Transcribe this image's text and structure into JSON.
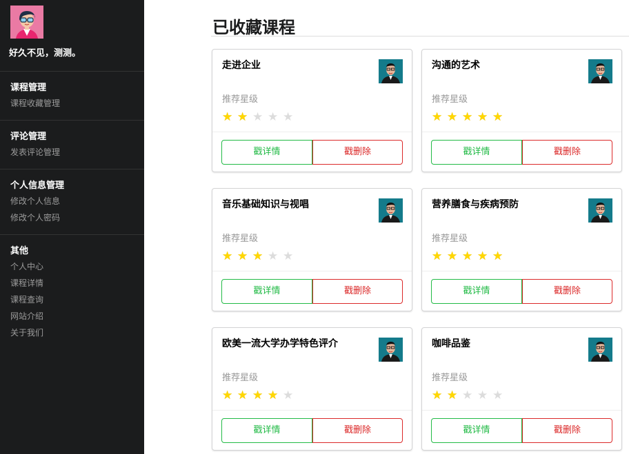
{
  "user": {
    "greeting": "好久不见，测测。"
  },
  "sidebar": {
    "sections": [
      {
        "title": "课程管理",
        "items": [
          "课程收藏管理"
        ]
      },
      {
        "title": "评论管理",
        "items": [
          "发表评论管理"
        ]
      },
      {
        "title": "个人信息管理",
        "items": [
          "修改个人信息",
          "修改个人密码"
        ]
      },
      {
        "title": "其他",
        "items": [
          "个人中心",
          "课程详情",
          "课程查询",
          "网站介绍",
          "关于我们"
        ]
      }
    ]
  },
  "main": {
    "title": "已收藏课程",
    "rating_label": "推荐星级",
    "detail_label": "戳详情",
    "delete_label": "戳删除",
    "colors": {
      "green": "#21ba45",
      "red": "#db2828",
      "star": "#ffd700",
      "sidebar_bg": "#1b1c1d"
    },
    "courses": [
      {
        "title": "走进企业",
        "rating": 2
      },
      {
        "title": "沟通的艺术",
        "rating": 5
      },
      {
        "title": "音乐基础知识与视唱",
        "rating": 3
      },
      {
        "title": "营养膳食与疾病预防",
        "rating": 5
      },
      {
        "title": "欧美一流大学办学特色评介",
        "rating": 4
      },
      {
        "title": "咖啡品鉴",
        "rating": 2
      }
    ]
  }
}
